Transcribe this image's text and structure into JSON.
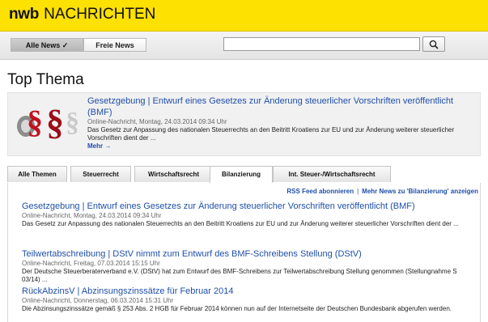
{
  "header": {
    "brand_short": "nwb",
    "brand_label": "NACHRICHTEN",
    "bg_color": "#fde100"
  },
  "filter": {
    "all_news_label": "Alle News ✓",
    "free_news_label": "Freie News"
  },
  "search": {
    "value": "",
    "placeholder": ""
  },
  "page_title": "Top Thema",
  "featured": {
    "title": "Gesetzgebung | Entwurf eines Gesetzes zur Änderung steuerlicher Vorschriften veröffentlicht (BMF)",
    "meta": "Online-Nachricht, Montag, 24.03.2014 09:34 Uhr",
    "teaser": "Das Gesetz zur Anpassung des nationalen Steuerrechts an den Beitritt Kroatiens zur EU und zur Änderung weiterer steuerlicher Vorschriften dient der ...",
    "more_label": "Mehr →"
  },
  "tabs": [
    "Alle Themen",
    "Steuerrecht",
    "Wirtschaftsrecht",
    "Bilanzierung",
    "Int. Steuer-/Wirtschaftsrecht"
  ],
  "active_tab": "Bilanzierung",
  "rss": {
    "subscribe_label": "RSS Feed abonnieren",
    "separator": "|",
    "more_label": "Mehr News zu 'Bilanzierung' anzeigen"
  },
  "items": [
    {
      "title": "Gesetzgebung | Entwurf eines Gesetzes zur Änderung steuerlicher Vorschriften veröffentlicht (BMF)",
      "meta": "Online-Nachricht, Montag, 24.03.2014 09:34 Uhr",
      "teaser": "Das Gesetz zur Anpassung des nationalen Steuerrechts an den Beitritt Kroatiens zur EU und zur Änderung weiterer steuerlicher Vorschriften dient der ..."
    },
    {
      "title": "Teilwertabschreibung | DStV nimmt zum Entwurf des BMF-Schreibens Stellung (DStV)",
      "meta": "Online-Nachricht, Freitag, 07.03.2014 15:15 Uhr",
      "teaser": "Der Deutsche Steuerberaterverband e.V. (DStV) hat zum Entwurf des BMF-Schreibens zur Teilwertabschreibung Stellung genommen (Stellungnahme S 03/14) ..."
    },
    {
      "title": "RückAbzinsV | Abzinsungszinssätze für Februar 2014",
      "meta": "Online-Nachricht, Donnerstag, 06.03.2014 15:31 Uhr",
      "teaser": "Die Abzinsungszinssätze gemäß § 253 Abs. 2 HGB für Februar 2014 können nun auf der Internetseite der Deutschen Bundesbank abgerufen werden."
    }
  ]
}
